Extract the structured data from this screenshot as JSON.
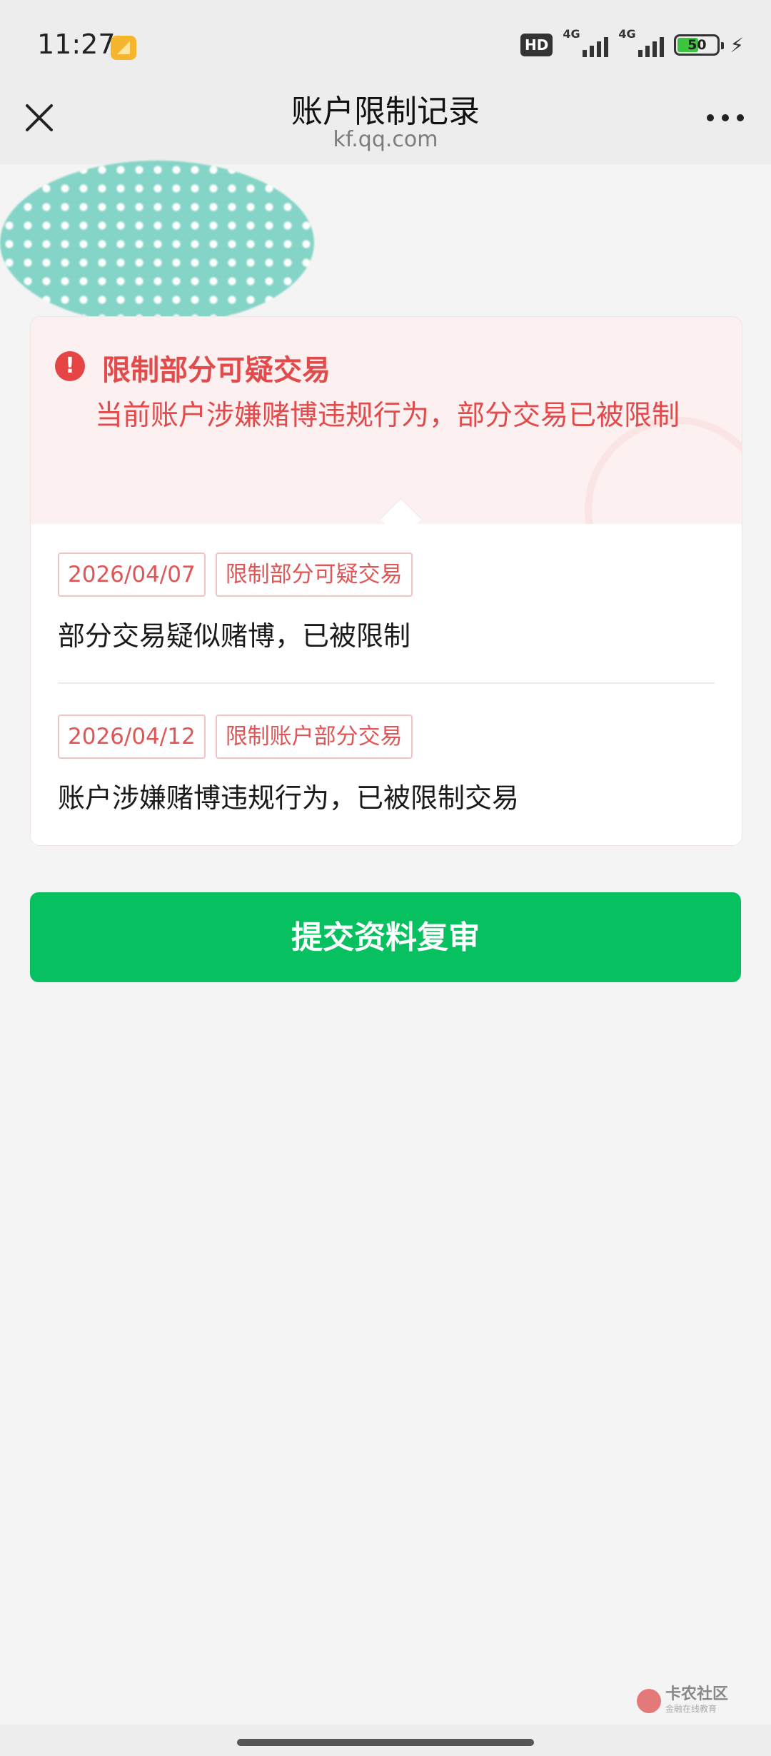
{
  "status_bar": {
    "time": "11:27",
    "hd_label": "HD",
    "network_1": "4G",
    "network_2": "4G",
    "battery_level": "50"
  },
  "nav": {
    "title": "账户限制记录",
    "subtitle": "kf.qq.com"
  },
  "alert": {
    "icon": "!",
    "title": "限制部分可疑交易",
    "description": "当前账户涉嫌赌博违规行为，部分交易已被限制"
  },
  "records": [
    {
      "date": "2026/04/07",
      "type": "限制部分可疑交易",
      "text": "部分交易疑似赌博，已被限制"
    },
    {
      "date": "2026/04/12",
      "type": "限制账户部分交易",
      "text": "账户涉嫌赌博违规行为，已被限制交易"
    }
  ],
  "submit_label": "提交资料复审",
  "watermark": {
    "text": "卡农社区",
    "sub": "金融在线教育"
  },
  "colors": {
    "accent_green": "#07c160",
    "alert_red": "#e24b4b",
    "alert_bg": "#fdf0f0"
  }
}
